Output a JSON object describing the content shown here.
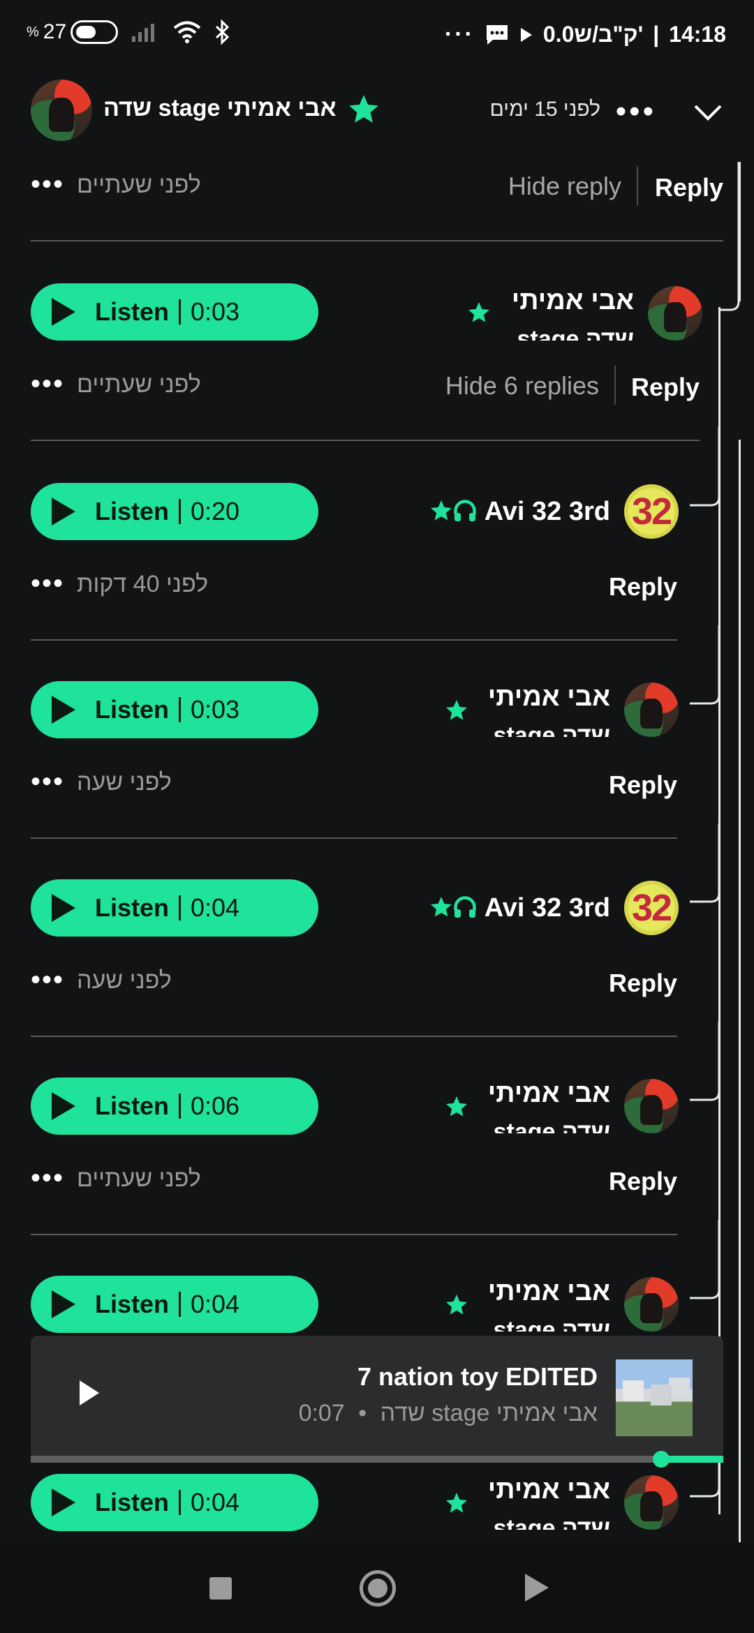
{
  "status_bar": {
    "time": "14:18",
    "net_speed": "0.0ק\"ב/ש'",
    "battery_level": "27",
    "battery_unit": "%"
  },
  "header": {
    "title": "אבי אמיתי stage שדה",
    "time_ago": "לפני 15 ימים",
    "more": "•••"
  },
  "top_reply_row": {
    "time_ago": "לפני שעתיים",
    "hide_reply": "Hide reply",
    "reply": "Reply"
  },
  "first_comment": {
    "name": "אבי אמיתי",
    "sub": "שדה stage",
    "listen": "Listen",
    "duration": "0:03",
    "time_ago": "לפני שעתיים",
    "hide_replies": "Hide 6 replies",
    "reply": "Reply"
  },
  "replies": [
    {
      "kind": "avi32",
      "name": "Avi 32 3rd",
      "avatar_text": "32",
      "listen": "Listen",
      "duration": "0:20",
      "time_ago": "לפני 40 דקות",
      "reply": "Reply"
    },
    {
      "kind": "stage",
      "name": "אבי אמיתי",
      "sub": "שדה stage",
      "listen": "Listen",
      "duration": "0:03",
      "time_ago": "לפני שעה",
      "reply": "Reply"
    },
    {
      "kind": "avi32",
      "name": "Avi 32 3rd",
      "avatar_text": "32",
      "listen": "Listen",
      "duration": "0:04",
      "time_ago": "לפני שעה",
      "reply": "Reply"
    },
    {
      "kind": "stage",
      "name": "אבי אמיתי",
      "sub": "שדה stage",
      "listen": "Listen",
      "duration": "0:06",
      "time_ago": "לפני שעתיים",
      "reply": "Reply"
    },
    {
      "kind": "stage",
      "name": "אבי אמיתי",
      "sub": "שדה stage",
      "listen": "Listen",
      "duration": "0:04"
    },
    {
      "kind": "stage",
      "name": "אבי אמיתי",
      "sub": "שדה stage",
      "listen": "Listen",
      "duration": "0:04"
    }
  ],
  "player": {
    "title": "7 nation toy EDITED",
    "artist": "אבי אמיתי stage שדה",
    "separator": "•",
    "elapsed": "0:07",
    "progress_fraction": 0.09
  },
  "colors": {
    "accent": "#1fe39a",
    "background": "#121314",
    "muted_text": "#9a9a9a"
  },
  "icons": {
    "star": "star-icon",
    "headphones": "headphones-icon",
    "play": "play-icon",
    "chevron": "chevron-down-icon"
  }
}
